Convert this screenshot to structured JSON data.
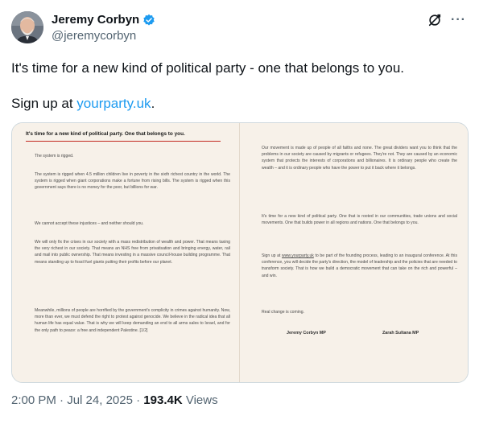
{
  "author": {
    "name": "Jeremy Corbyn",
    "handle": "@jeremycorbyn",
    "verified": true,
    "verified_color": "#1d9bf0"
  },
  "tweet": {
    "line1": "It's time for a new kind of political party - one that belongs to you.",
    "line2_prefix": "Sign up at ",
    "link_text": "yourparty.uk",
    "line2_suffix": ".",
    "link_color": "#1d9bf0"
  },
  "document": {
    "heading": "It's time for a new kind of political party. One that belongs to you.",
    "left": [
      "The system is rigged.",
      "The system is rigged when 4.5 million children live in poverty in the sixth richest country in the world. The system is rigged when giant corporations make a fortune from rising bills. The system is rigged when this government says there is no money for the poor, but billions for war.",
      "We cannot accept these injustices – and neither should you.",
      "We will only fix the crises in our society with a mass redistribution of wealth and power. That means taxing the very richest in our society. That means an NHS free from privatisation and bringing energy, water, rail and mail into public ownership. That means investing in a massive council-house building programme. That means standing up to fossil fuel giants putting their profits before our planet.",
      "Meanwhile, millions of people are horrified by the government's complicity in crimes against humanity. Now, more than ever, we must defend the right to protest against genocide. We believe in the radical idea that all human life has equal value. That is why we will keep demanding an end to all arms sales to Israel, and for the only path to peace: a free and independent Palestine. [1/2]"
    ],
    "right": [
      "Our movement is made up of people of all faiths and none. The great dividers want you to think that the problems in our society are caused by migrants or refugees. They're not. They are caused by an economic system that protects the interests of corporations and billionaires. It is ordinary people who create the wealth – and it is ordinary people who have the power to put it back where it belongs.",
      "It's time for a new kind of political party. One that is rooted in our communities, trade unions and social movements. One that builds power in all regions and nations. One that belongs to you.",
      "Real change is coming."
    ],
    "signup_prefix": "Sign up at ",
    "signup_link": "www.yourparty.uk",
    "signup_rest": " to be part of the founding process, leading to an inaugural conference. At this conference, you will decide the party's direction, the model of leadership and the policies that are needed to transform society. That is how we build a democratic movement that can take on the rich and powerful – and win.",
    "signatories": [
      "Jeremy Corbyn MP",
      "Zarah Sultana MP"
    ],
    "accent_color": "#c2281f"
  },
  "meta": {
    "time": "2:00 PM",
    "date": "Jul 24, 2025",
    "separator": "·",
    "views_count": "193.4K",
    "views_label": "Views"
  },
  "icons": {
    "verified": "verified-badge-icon",
    "grok": "grok-icon",
    "more": "more-icon"
  }
}
